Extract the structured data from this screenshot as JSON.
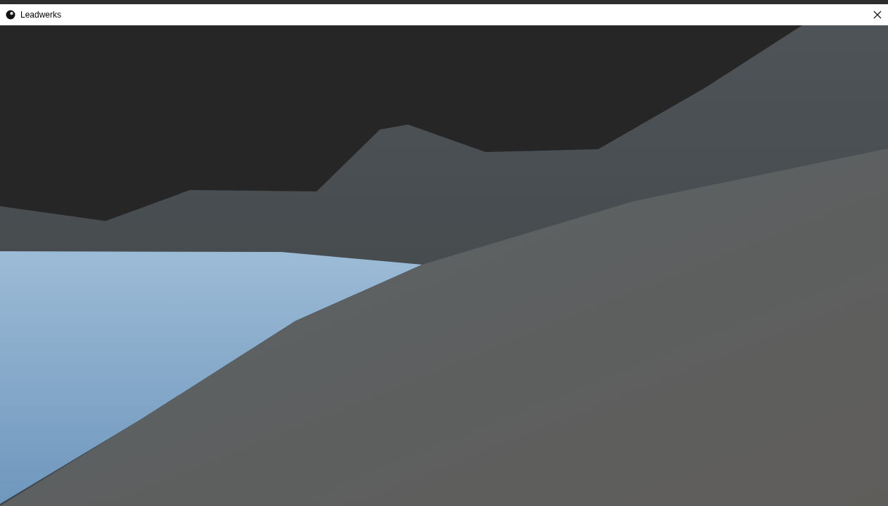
{
  "window": {
    "title": "Leadwerks"
  }
}
